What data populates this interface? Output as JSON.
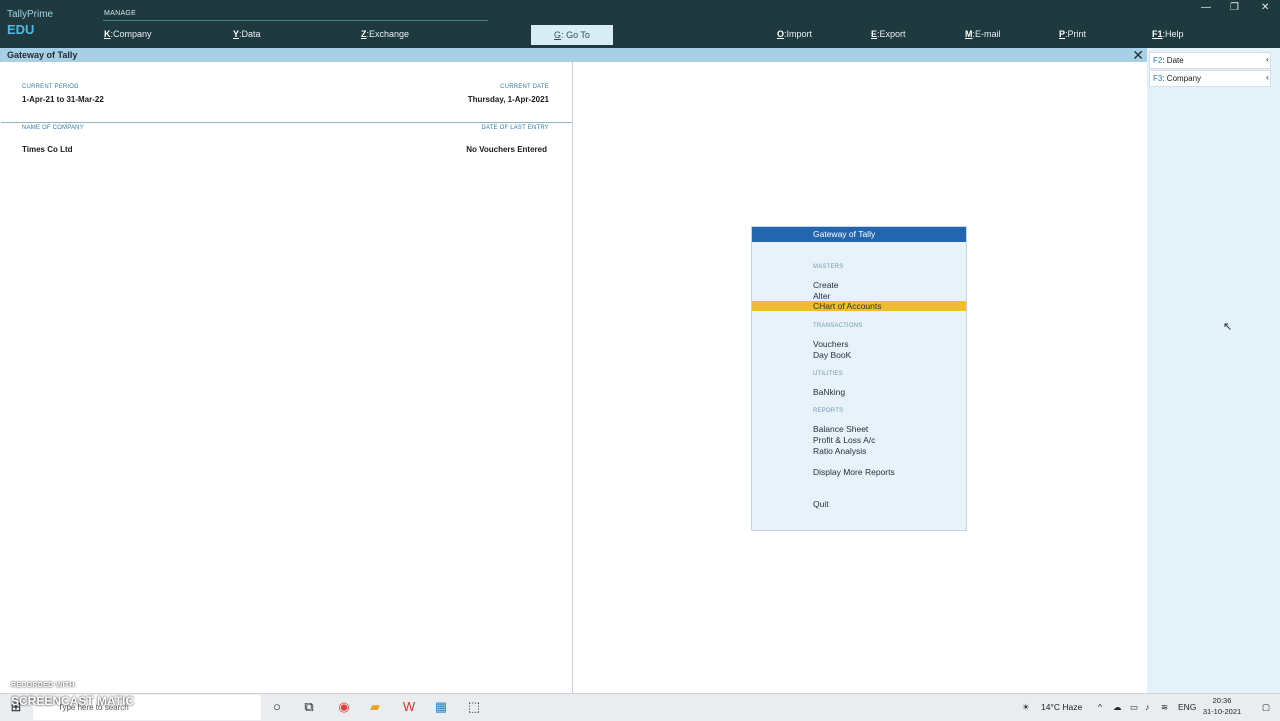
{
  "app": {
    "name": "TallyPrime",
    "edition": "EDU"
  },
  "header": {
    "manage_label": "MANAGE",
    "menu": [
      {
        "key": "K",
        "label": "Company"
      },
      {
        "key": "Y",
        "label": "Data"
      },
      {
        "key": "Z",
        "label": "Exchange"
      },
      {
        "key": "G",
        "label": "Go To"
      },
      {
        "key": "O",
        "label": "Import"
      },
      {
        "key": "E",
        "label": "Export"
      },
      {
        "key": "M",
        "label": "E-mail"
      },
      {
        "key": "P",
        "label": "Print"
      },
      {
        "key": "F1",
        "label": "Help"
      }
    ],
    "window_controls": {
      "minimize": "—",
      "restore": "❐",
      "close": "✕"
    }
  },
  "titlebar": {
    "title": "Gateway of Tally",
    "close": "✕"
  },
  "company_panel": {
    "current_period_label": "CURRENT PERIOD",
    "current_period": "1-Apr-21 to 31-Mar-22",
    "current_date_label": "CURRENT DATE",
    "current_date": "Thursday, 1-Apr-2021",
    "name_of_company_label": "NAME OF COMPANY",
    "date_of_last_entry_label": "DATE OF LAST ENTRY",
    "company_name": "Times Co Ltd",
    "last_entry": "No Vouchers Entered"
  },
  "side_buttons": [
    {
      "key": "F2",
      "label": "Date"
    },
    {
      "key": "F3",
      "label": "Company"
    }
  ],
  "gateway": {
    "title": "Gateway of Tally",
    "masters_label": "MASTERS",
    "create": "Create",
    "alter": "Alter",
    "chart_of_accounts": "CHart of Accounts",
    "transactions_label": "TRANSACTIONS",
    "vouchers": "Vouchers",
    "day_book": "Day BooK",
    "utilities_label": "UTILITIES",
    "banking": "BaNking",
    "reports_label": "REPORTS",
    "balance_sheet": "Balance Sheet",
    "profit_loss": "Profit & Loss A/c",
    "ratio_analysis": "Ratio Analysis",
    "display_more": "Display More Reports",
    "quit": "Quit"
  },
  "taskbar": {
    "search_placeholder": "Type here to search",
    "weather": "14°C  Haze",
    "language": "ENG",
    "time": "20:36",
    "date": "31-10-2021"
  },
  "watermark": {
    "line1": "RECORDED WITH",
    "line2": "SCREENCAST  MATIC"
  },
  "colors": {
    "header_bg": "#1f3a3f",
    "titlebar_bg": "#a7d0e7",
    "gateway_head": "#2466ad",
    "selection": "#f2bd2c",
    "side_panel": "#e3f1f8"
  }
}
